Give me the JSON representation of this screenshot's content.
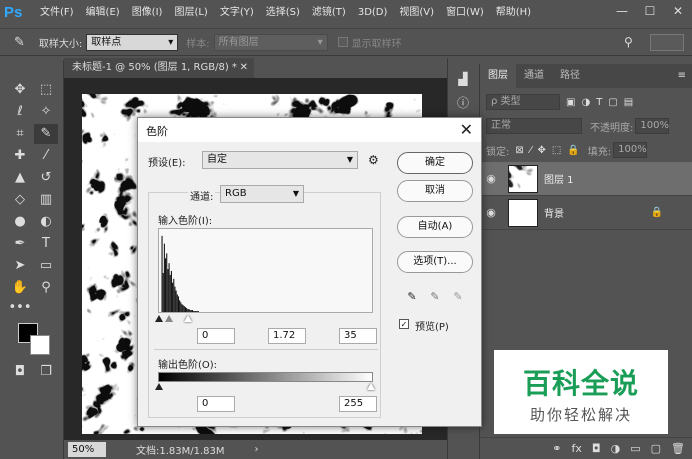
{
  "app": {
    "logo": "Ps"
  },
  "menu": [
    "文件(F)",
    "编辑(E)",
    "图像(I)",
    "图层(L)",
    "文字(Y)",
    "选择(S)",
    "滤镜(T)",
    "3D(D)",
    "视图(V)",
    "窗口(W)",
    "帮助(H)"
  ],
  "window_controls": {
    "minimize": "—",
    "maximize": "☐",
    "close": "✕"
  },
  "options": {
    "sample_size_label": "取样大小:",
    "sample_size_value": "取样点",
    "sample_label": "样本:",
    "sample_value": "所有图层",
    "show_ring_label": "显示取样环"
  },
  "document": {
    "tab_title": "未标题-1 @ 50% (图层 1, RGB/8) *",
    "tab_close": "✕"
  },
  "status": {
    "zoom": "50%",
    "doc_info": "文档:1.83M/1.83M",
    "arrow": "›"
  },
  "layers_panel": {
    "tabs": [
      "图层",
      "通道",
      "路径"
    ],
    "filter_placeholder": "ρ 类型",
    "blend_mode": "正常",
    "opacity_label": "不透明度:",
    "opacity_value": "100%",
    "lock_label": "锁定:",
    "fill_label": "填充:",
    "fill_value": "100%",
    "layers": [
      {
        "name": "图层 1",
        "selected": true
      },
      {
        "name": "背景",
        "selected": false
      }
    ],
    "footer_icons": [
      "⚭",
      "fx",
      "◘",
      "◑",
      "▭",
      "▢",
      "🗑"
    ]
  },
  "levels": {
    "title": "色阶",
    "close": "✕",
    "preset_label": "预设(E):",
    "preset_value": "自定",
    "preset_gear": "⚙",
    "channel_label": "通道:",
    "channel_value": "RGB",
    "input_label": "输入色阶(I):",
    "input_black": "0",
    "input_gamma": "1.72",
    "input_white": "35",
    "output_label": "输出色阶(O):",
    "output_black": "0",
    "output_white": "255",
    "buttons": {
      "ok": "确定",
      "cancel": "取消",
      "auto": "自动(A)",
      "options": "选项(T)..."
    },
    "preview_label": "预览(P)",
    "preview_checked": true
  },
  "watermark": {
    "title": "百科全说",
    "subtitle": "助你轻松解决"
  },
  "colors": {
    "ui_dark": "#535353",
    "ps_blue": "#31a8ff",
    "watermark_green": "#1a9e57"
  }
}
